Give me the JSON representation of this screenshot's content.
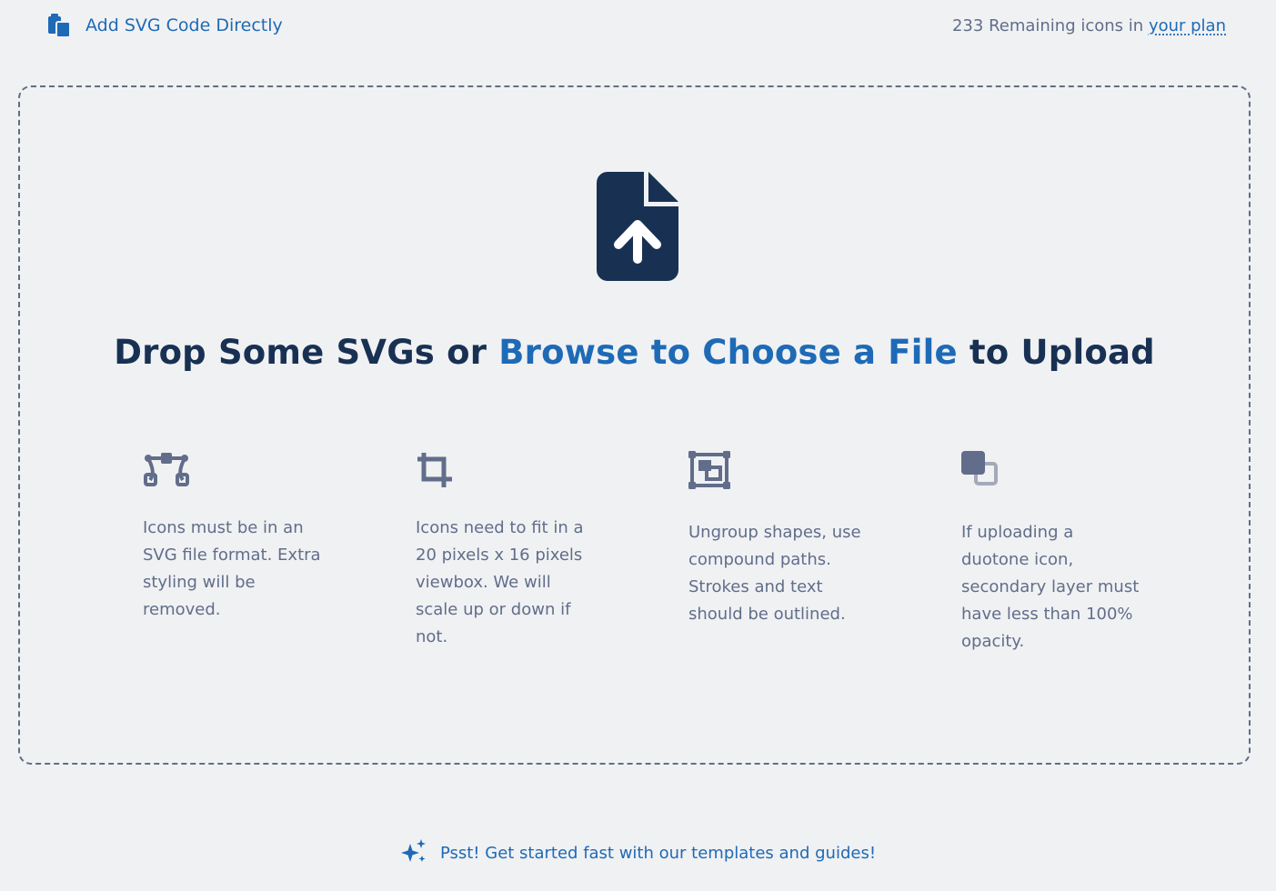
{
  "header": {
    "add_svg_label": "Add SVG Code Directly",
    "remaining_prefix": "233 Remaining icons in",
    "plan_link": "your plan",
    "icon": "paste-icon"
  },
  "dropzone": {
    "icon": "file-arrow-up-icon",
    "headline_before": "Drop Some SVGs or",
    "headline_link": "Browse to Choose a File",
    "headline_after": "to Upload",
    "tips": [
      {
        "icon": "bezier-curve-icon",
        "text": "Icons must be in an SVG file format. Extra styling will be removed."
      },
      {
        "icon": "crop-icon",
        "text": "Icons need to fit in a 20 pixels x 16 pixels viewbox. We will scale up or down if not."
      },
      {
        "icon": "object-ungroup-icon",
        "text": "Ungroup shapes, use compound paths. Strokes and text should be outlined."
      },
      {
        "icon": "clone-duotone-icon",
        "text": "If uploading a duotone icon, secondary layer must have less than 100% opacity."
      }
    ]
  },
  "footer": {
    "icon": "sparkles-icon",
    "text": "Psst! Get started fast with our templates and guides!"
  },
  "colors": {
    "background": "#f0f1f3",
    "brand_blue": "#1e6ab6",
    "navy": "#183153",
    "gray": "#616d8a"
  }
}
